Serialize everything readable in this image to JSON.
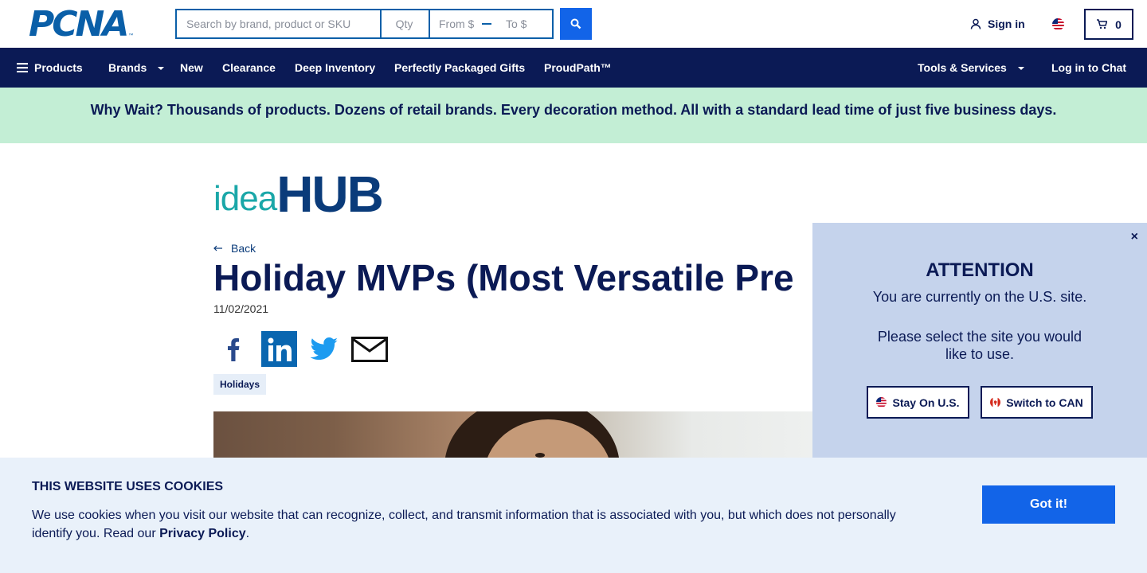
{
  "header": {
    "logo_text": "PCNA",
    "logo_tm": "™",
    "search_placeholder": "Search by brand, product or SKU",
    "qty_placeholder": "Qty",
    "from_placeholder": "From $",
    "to_placeholder": "To $",
    "search_icon": "search-icon",
    "signin_label": "Sign in",
    "user_icon": "user-icon",
    "flag_icon": "us-flag-icon",
    "cart_icon": "cart-icon",
    "cart_count": "0"
  },
  "nav": {
    "products": "Products",
    "brands": "Brands",
    "new": "New",
    "clearance": "Clearance",
    "deep_inventory": "Deep Inventory",
    "gifts": "Perfectly Packaged Gifts",
    "proudpath": "ProudPath™",
    "tools": "Tools & Services",
    "chat": "Log in to Chat"
  },
  "promo": {
    "text": "Why Wait? Thousands of products. Dozens of retail brands. Every decoration method. All with a standard lead time of just five business days."
  },
  "article": {
    "brand_idea": "idea",
    "brand_hub": "HUB",
    "back_label": "Back",
    "title": "Holiday MVPs (Most Versatile Pre",
    "date": "11/02/2021",
    "tag": "Holidays"
  },
  "attention": {
    "close": "×",
    "title": "ATTENTION",
    "message1": "You are currently on the U.S. site.",
    "message2": "Please select the site you would like to use.",
    "stay_label": "Stay On U.S.",
    "switch_label": "Switch to CAN"
  },
  "cookies": {
    "title": "THIS WEBSITE USES COOKIES",
    "text": "We use cookies when you visit our website that can recognize, collect, and transmit information that is associated with you, but which does not personally identify you. Read our ",
    "link": "Privacy Policy",
    "end": ".",
    "button": "Got it!"
  },
  "colors": {
    "navy": "#0b1a55",
    "brand_blue": "#0a5fa8",
    "button_blue": "#1264e8",
    "promo_green": "#c3eed5",
    "panel_blue": "#c5d3ec",
    "cookie_bg": "#e9f1fa",
    "teal": "#1aa7a8"
  }
}
